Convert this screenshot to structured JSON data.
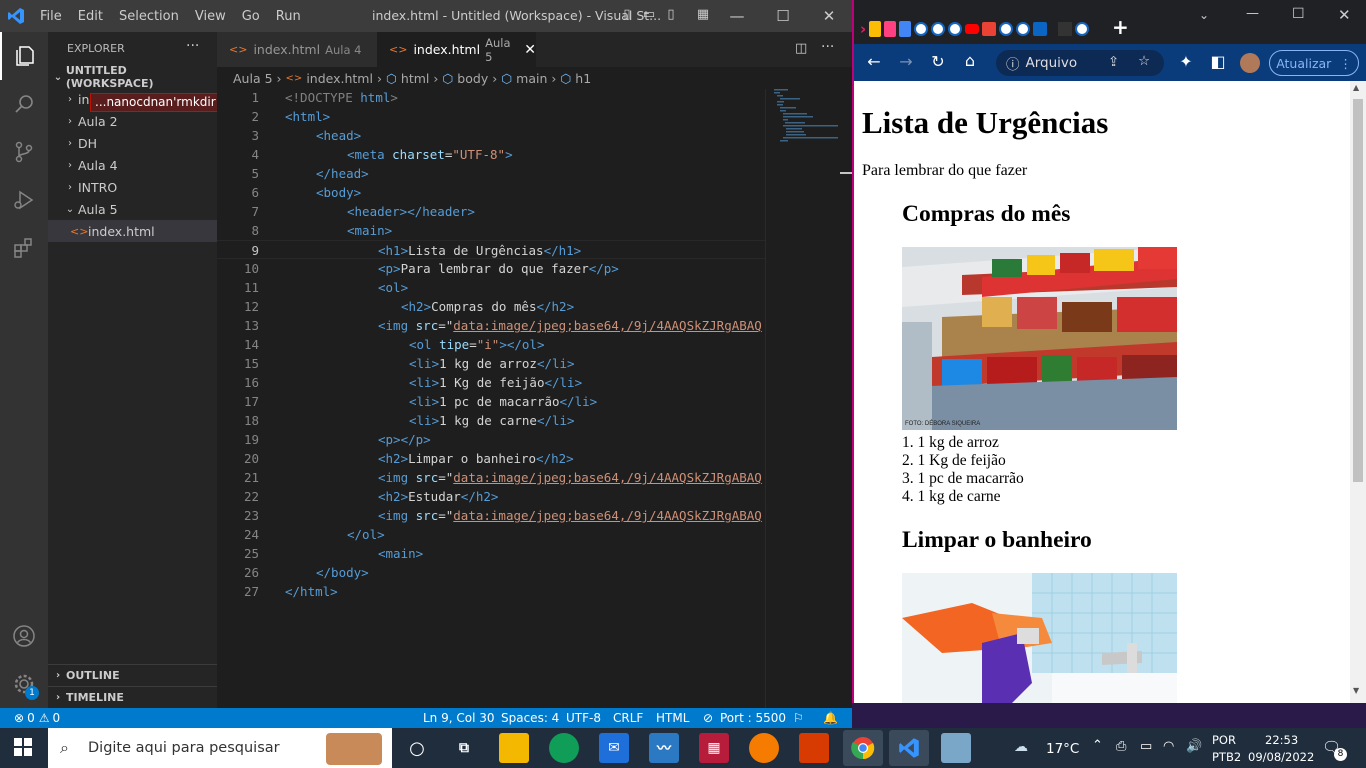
{
  "vscode": {
    "menu": [
      "File",
      "Edit",
      "Selection",
      "View",
      "Go",
      "Run"
    ],
    "window_title": "index.html - Untitled (Workspace) - Visual St...",
    "explorer": {
      "header": "EXPLORER",
      "more": "···",
      "workspace": "UNTITLED (WORKSPACE)",
      "folders": [
        {
          "label": "in",
          "expanded": false
        },
        {
          "label": "Aula 2",
          "expanded": false
        },
        {
          "label": "DH",
          "expanded": false
        },
        {
          "label": "Aula 4",
          "expanded": false
        },
        {
          "label": "INTRO",
          "expanded": false
        },
        {
          "label": "Aula 5",
          "expanded": true
        }
      ],
      "rename_tooltip": "...nanocdnan'rmkdir",
      "file": "index.html",
      "outline": "OUTLINE",
      "timeline": "TIMELINE"
    },
    "tabs": [
      {
        "label": "index.html",
        "desc": "Aula 4",
        "active": false
      },
      {
        "label": "index.html",
        "desc": "Aula 5",
        "active": true
      }
    ],
    "breadcrumb": [
      "Aula 5",
      "index.html",
      "html",
      "body",
      "main",
      "h1"
    ],
    "code_lines": [
      {
        "n": "1"
      },
      {
        "n": "2"
      },
      {
        "n": "3"
      },
      {
        "n": "4"
      },
      {
        "n": "5"
      },
      {
        "n": "6"
      },
      {
        "n": "7"
      },
      {
        "n": "8"
      },
      {
        "n": "9"
      },
      {
        "n": "10"
      },
      {
        "n": "11"
      },
      {
        "n": "12"
      },
      {
        "n": "13"
      },
      {
        "n": "14"
      },
      {
        "n": "15"
      },
      {
        "n": "16"
      },
      {
        "n": "17"
      },
      {
        "n": "18"
      },
      {
        "n": "19"
      },
      {
        "n": "20"
      },
      {
        "n": "21"
      },
      {
        "n": "22"
      },
      {
        "n": "23"
      },
      {
        "n": "24"
      },
      {
        "n": "25"
      },
      {
        "n": "26"
      },
      {
        "n": "27"
      }
    ],
    "code_text": {
      "l1a": "<!DOCTYPE ",
      "l1b": "html",
      "l1c": ">",
      "l2": "<html>",
      "l3": "<head>",
      "l4a": "<meta ",
      "l4b": "charset",
      "l4c": "=",
      "l4d": "\"UTF-8\"",
      "l4e": ">",
      "l5": "</head>",
      "l6": "<body>",
      "l7": "<header></header>",
      "l8": "<main>",
      "l9a": "<h1>",
      "l9b": "Lista de Urgências",
      "l9c": "</h1>",
      "l10a": "<p>",
      "l10b": "Para lembrar do que fazer",
      "l10c": "</p>",
      "l11": "<ol>",
      "l12a": "<h2>",
      "l12b": "Compras do mês",
      "l12c": "</h2>",
      "img_a": "<img ",
      "img_b": "src",
      "img_c": "=\"",
      "img_d": "data:image/jpeg;base64,/9j/4AAQSkZJRgABAQ",
      "l14a": "<ol ",
      "l14b": "tipe",
      "l14c": "=",
      "l14d": "\"i\"",
      "l14e": "></ol>",
      "l15a": "<li>",
      "l15b": "1 kg de arroz",
      "l15c": "</li>",
      "l16a": "<li>",
      "l16b": "1 Kg de feijão",
      "l16c": "</li>",
      "l17a": "<li>",
      "l17b": "1 pc de macarrão",
      "l17c": "</li>",
      "l18a": "<li>",
      "l18b": "1 kg de carne",
      "l18c": "</li>",
      "l19": "<p></p>",
      "l20a": "<h2>",
      "l20b": "Limpar o banheiro",
      "l20c": "</h2>",
      "l22a": "<h2>",
      "l22b": "Estudar",
      "l22c": "</h2>",
      "l24": "</ol>",
      "l25": "<main>",
      "l26": "</body>",
      "l27": "</html>"
    },
    "status": {
      "errors": "0",
      "warnings": "0",
      "position": "Ln 9, Col 30",
      "spaces": "Spaces: 4",
      "encoding": "UTF-8",
      "eol": "CRLF",
      "language": "HTML",
      "port": "Port : 5500"
    },
    "accounts_badge": "1"
  },
  "chrome": {
    "new_tab": "+",
    "omnibox": "Arquivo",
    "update_button": "Atualizar",
    "page": {
      "h1": "Lista de Urgências",
      "p": "Para lembrar do que fazer",
      "h2_1": "Compras do mês",
      "photo_credit": "FOTO: DÉBORA SIQUEIRA",
      "items": [
        "1 kg de arroz",
        "1 Kg de feijão",
        "1 pc de macarrão",
        "1 kg de carne"
      ],
      "h2_2": "Limpar o banheiro"
    }
  },
  "taskbar": {
    "search_placeholder": "Digite aqui para pesquisar",
    "temperature": "17°C",
    "lang1": "POR",
    "lang2": "PTB2",
    "time": "22:53",
    "date": "09/08/2022",
    "notifications": "8"
  },
  "colors": {
    "vs_blue": "#007acc",
    "chrome_toolbar": "#0a3b7a",
    "accent": "#c0007a"
  }
}
